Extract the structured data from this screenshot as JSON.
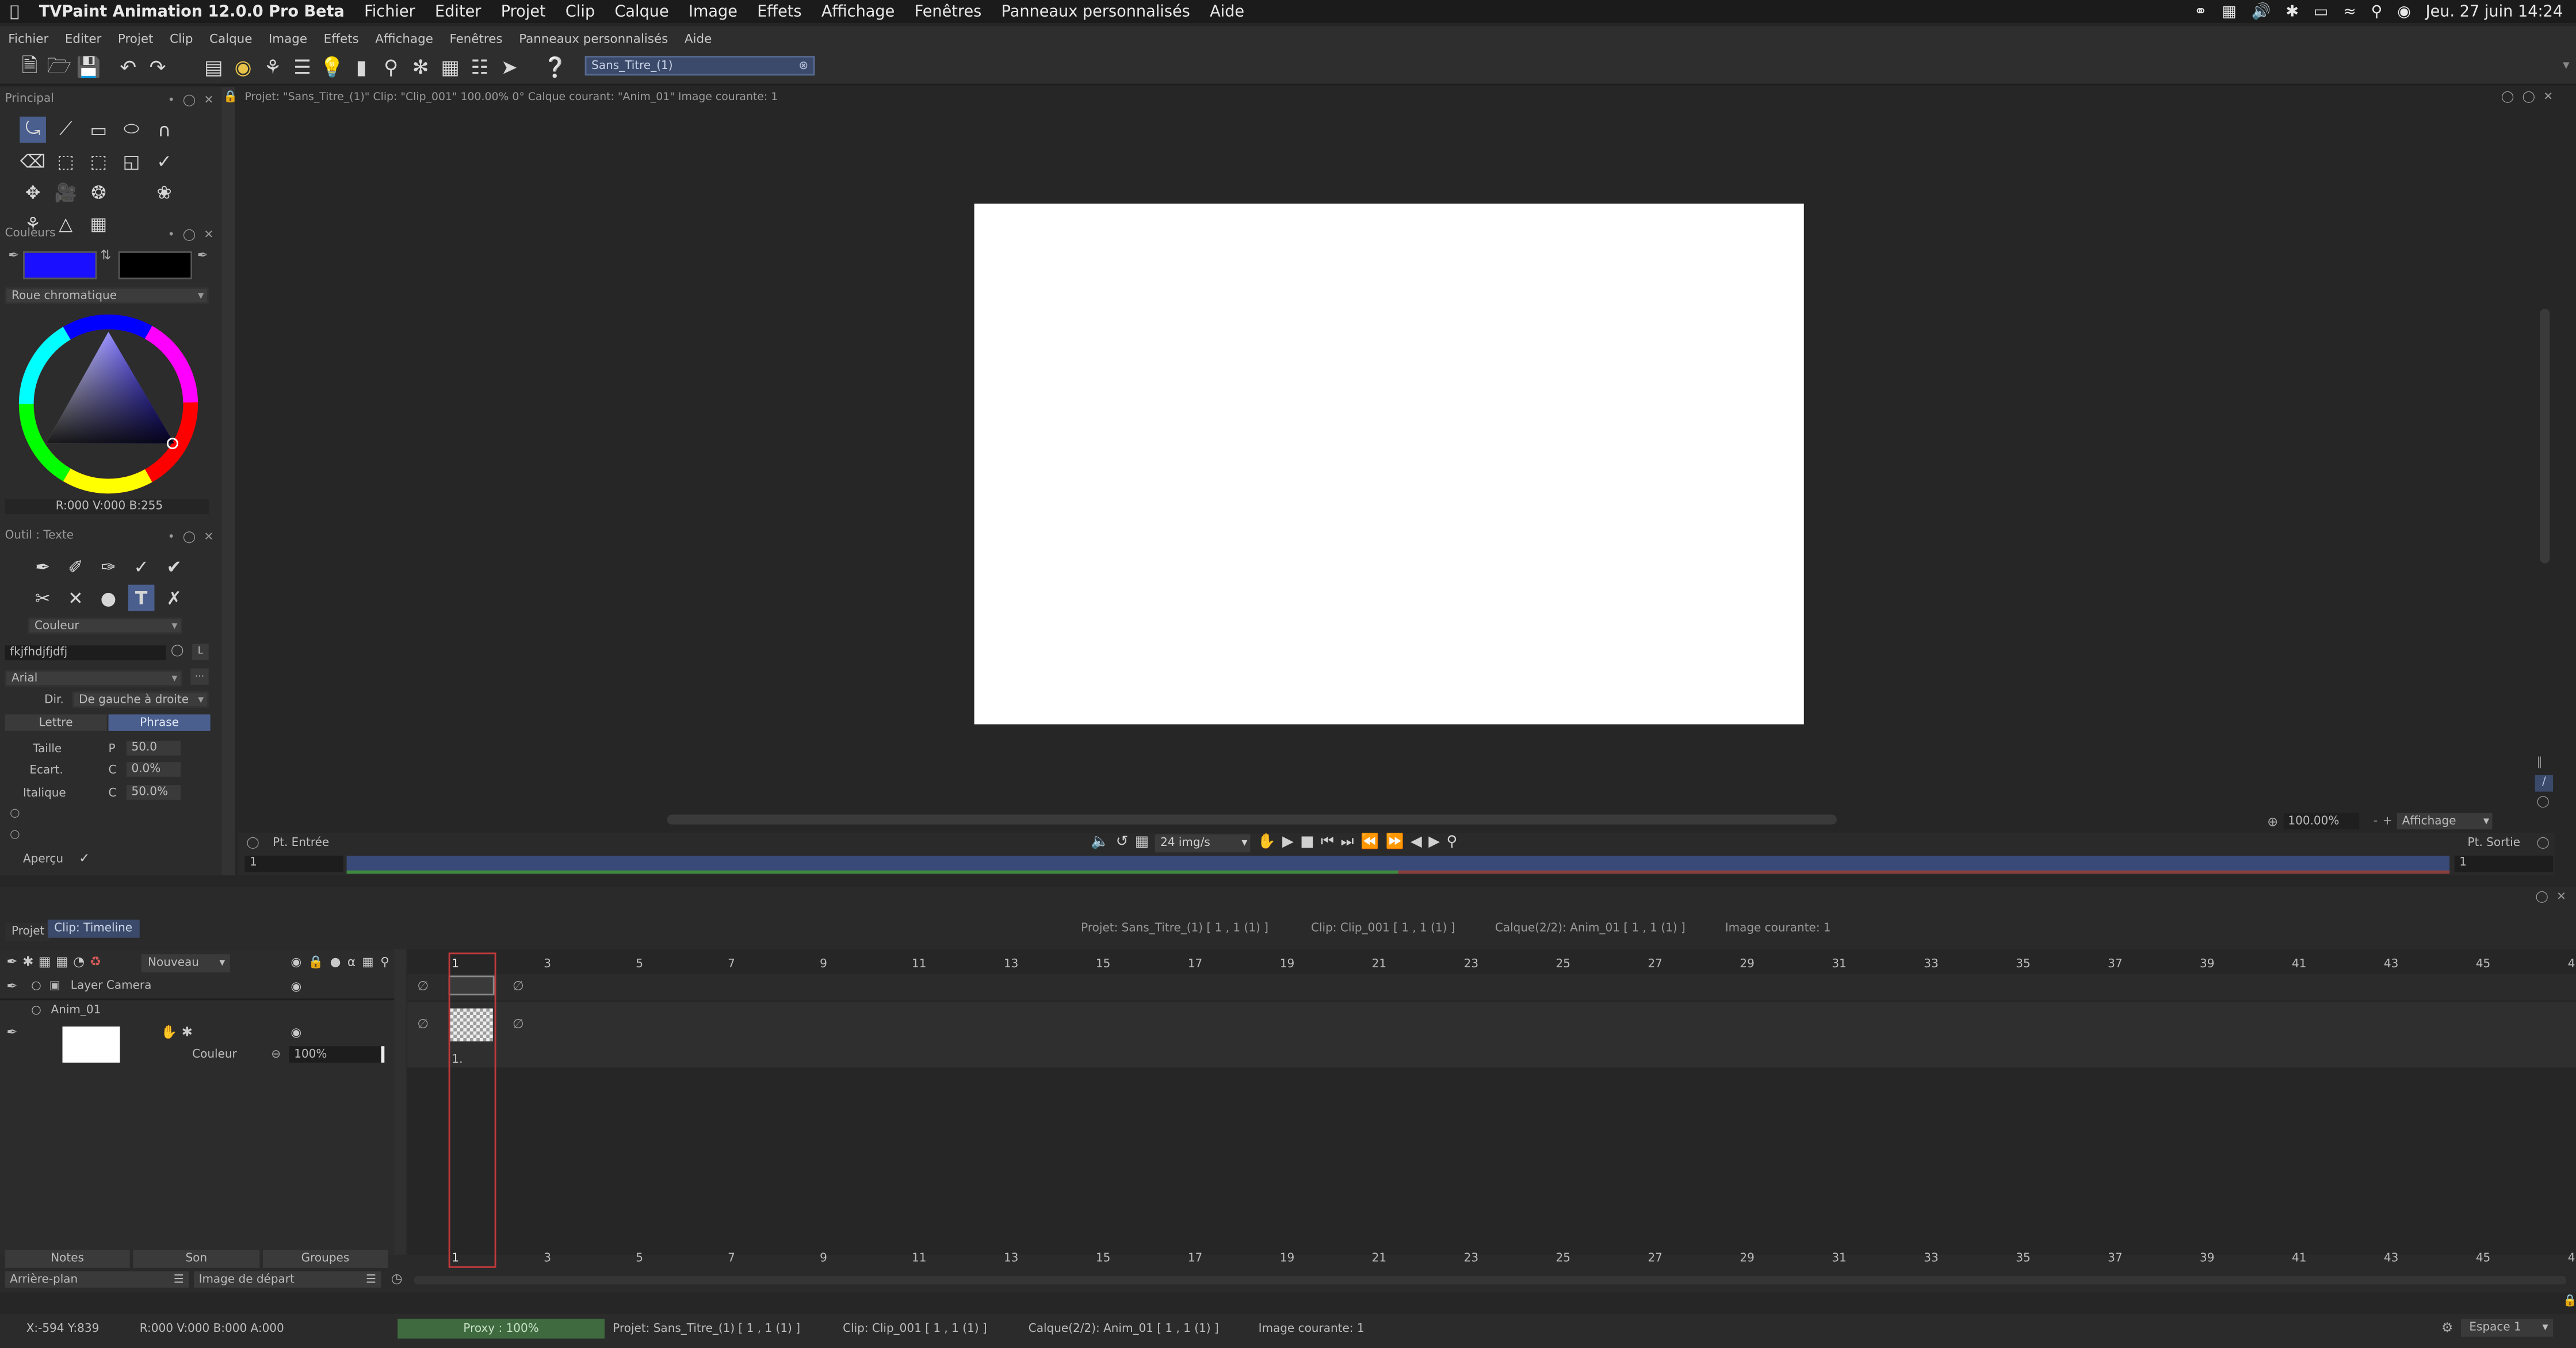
{
  "macbar": {
    "app_name": "TVPaint Animation 12.0.0 Pro Beta",
    "menus": [
      "Fichier",
      "Editer",
      "Projet",
      "Clip",
      "Calque",
      "Image",
      "Effets",
      "Affichage",
      "Fenêtres",
      "Panneaux personnalisés",
      "Aide"
    ],
    "datetime": "Jeu. 27 juin  14:24"
  },
  "appmenu": {
    "items": [
      "Fichier",
      "Editer",
      "Projet",
      "Clip",
      "Calque",
      "Image",
      "Effets",
      "Affichage",
      "Fenêtres",
      "Panneaux personnalisés",
      "Aide"
    ]
  },
  "toolbar": {
    "project_field": "Sans_Titre_(1)"
  },
  "info": {
    "text": "Projet: \"Sans_Titre_(1)\"  Clip: \"Clip_001\"  100.00%  0°  Calque courant: \"Anim_01\"  Image courante: 1"
  },
  "panels": {
    "principal": "Principal",
    "couleurs": "Couleurs",
    "color_mode": "Roue chromatique",
    "color_readout": "R:000 V:000 B:255",
    "tool_title": "Outil : Texte",
    "couleur_dd": "Couleur",
    "text_value": "fkjfhdjfjdfj",
    "font": "Arial",
    "dir_label": "Dir.",
    "dir_value": "De gauche à droite",
    "btn_lettre": "Lettre",
    "btn_phrase": "Phrase",
    "taille_label": "Taille",
    "taille_unit": "P",
    "taille_value": "50.0",
    "ecart_label": "Ecart.",
    "ecart_unit": "C",
    "ecart_value": "0.0%",
    "italique_label": "Italique",
    "italique_unit": "C",
    "italique_value": "50.0%",
    "apercu": "Aperçu",
    "primary_color": "#1a10ff",
    "secondary_color": "#000000"
  },
  "playback": {
    "in_label": "Pt. Entrée",
    "out_label": "Pt. Sortie",
    "fps": "24 img/s",
    "zoom": "100.00%",
    "view_dd": "Affichage",
    "in_frame": "1",
    "out_frame": "1"
  },
  "timeline": {
    "tab_project": "Projet",
    "tab_clip": "Clip: Timeline",
    "info_project": "Projet: Sans_Titre_(1) [ 1 , 1  (1) ]",
    "info_clip": "Clip: Clip_001 [ 1 , 1  (1) ]",
    "info_layer": "Calque(2/2): Anim_01 [ 1 , 1  (1) ]",
    "info_image": "Image courante: 1",
    "new_dd": "Nouveau",
    "layer_camera": "Layer Camera",
    "layer_anim": "Anim_01",
    "layer_mode": "Couleur",
    "layer_opacity": "100%",
    "frame_marker": "1.",
    "frame_numbers": [
      "1",
      "3",
      "5",
      "7",
      "9",
      "11",
      "13",
      "15",
      "17",
      "19",
      "21",
      "23",
      "25",
      "27",
      "29",
      "31",
      "33",
      "35",
      "37",
      "39",
      "41",
      "43",
      "45",
      "4"
    ],
    "btn_notes": "Notes",
    "btn_son": "Son",
    "btn_groupes": "Groupes",
    "bg_dd": "Arrière-plan",
    "start_dd": "Image de départ"
  },
  "status": {
    "coords": "X:-594  Y:839",
    "rgba": "R:000 V:000 B:000 A:000",
    "proxy": "Proxy : 100%",
    "project": "Projet: Sans_Titre_(1) [ 1 , 1  (1) ]",
    "clip": "Clip: Clip_001 [ 1 , 1  (1) ]",
    "layer": "Calque(2/2): Anim_01 [ 1 , 1  (1) ]",
    "image": "Image courante: 1",
    "space": "Espace 1"
  }
}
